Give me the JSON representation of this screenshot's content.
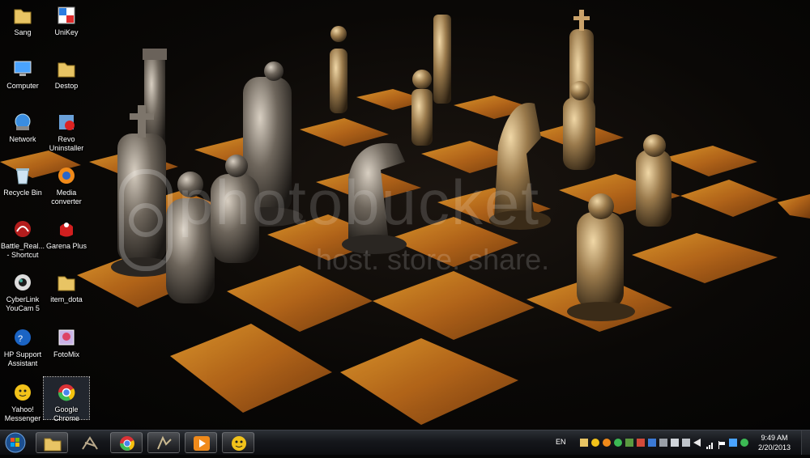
{
  "desktop": {
    "wallpaper": {
      "watermark_line1": "photobucket",
      "watermark_line2": "host. store. share."
    },
    "icons": [
      {
        "label": "Sang",
        "icon": "folder-icon"
      },
      {
        "label": "UniKey",
        "icon": "unikey-icon"
      },
      {
        "label": "Computer",
        "icon": "computer-icon"
      },
      {
        "label": "Destop",
        "icon": "folder-icon"
      },
      {
        "label": "Network",
        "icon": "network-icon"
      },
      {
        "label": "Revo\nUninstaller",
        "icon": "revo-uninstaller-icon"
      },
      {
        "label": "Recycle Bin",
        "icon": "recycle-bin-icon"
      },
      {
        "label": "Media\nconverter",
        "icon": "media-converter-icon"
      },
      {
        "label": "Battle_Real...\n- Shortcut",
        "icon": "battle-realms-icon"
      },
      {
        "label": "Garena Plus",
        "icon": "garena-plus-icon"
      },
      {
        "label": "CyberLink\nYouCam 5",
        "icon": "youcam-icon"
      },
      {
        "label": "item_dota",
        "icon": "folder-icon"
      },
      {
        "label": "HP Support\nAssistant",
        "icon": "hp-support-icon"
      },
      {
        "label": "FotoMix",
        "icon": "fotomix-icon"
      },
      {
        "label": "Yahoo!\nMessenger",
        "icon": "yahoo-messenger-icon"
      },
      {
        "label": "Google\nChrome",
        "icon": "chrome-icon"
      }
    ]
  },
  "taskbar": {
    "pinned": [
      {
        "name": "windows-explorer",
        "icon": "folder-icon"
      },
      {
        "name": "app-dragon",
        "icon": "dragon-icon"
      },
      {
        "name": "google-chrome",
        "icon": "chrome-icon"
      },
      {
        "name": "battle-realms",
        "icon": "battle-realms-icon"
      },
      {
        "name": "media-player",
        "icon": "play-icon"
      },
      {
        "name": "yahoo-messenger",
        "icon": "yahoo-messenger-icon"
      }
    ],
    "tray": {
      "language": "EN",
      "time": "9:49 AM",
      "date": "2/20/2013"
    }
  }
}
